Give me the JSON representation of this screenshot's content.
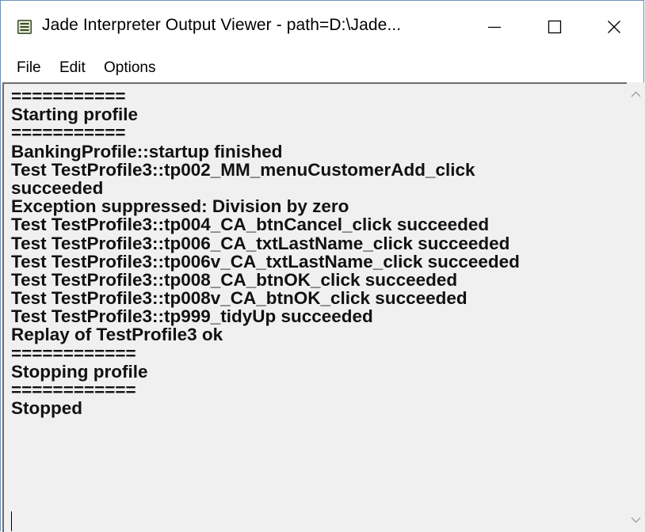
{
  "window": {
    "title": "Jade Interpreter Output Viewer - path=D:\\Jade...",
    "icon": "document-list-icon"
  },
  "controls": {
    "minimize_icon": "minimize-icon",
    "maximize_icon": "maximize-icon",
    "close_icon": "close-icon"
  },
  "menu": {
    "items": [
      "File",
      "Edit",
      "Options"
    ]
  },
  "output": {
    "lines": [
      "===========",
      "Starting profile",
      "===========",
      "BankingProfile::startup finished",
      "Test TestProfile3::tp002_MM_menuCustomerAdd_click",
      "succeeded",
      "Exception suppressed: Division by zero",
      "Test TestProfile3::tp004_CA_btnCancel_click succeeded",
      "Test TestProfile3::tp006_CA_txtLastName_click succeeded",
      "Test TestProfile3::tp006v_CA_txtLastName_click succeeded",
      "Test TestProfile3::tp008_CA_btnOK_click succeeded",
      "Test TestProfile3::tp008v_CA_btnOK_click succeeded",
      "Test TestProfile3::tp999_tidyUp succeeded",
      "Replay of TestProfile3 ok",
      "============",
      "Stopping profile",
      "============",
      "Stopped"
    ]
  },
  "scrollbar": {
    "up_icon": "chevron-up-icon",
    "down_icon": "chevron-down-icon"
  }
}
